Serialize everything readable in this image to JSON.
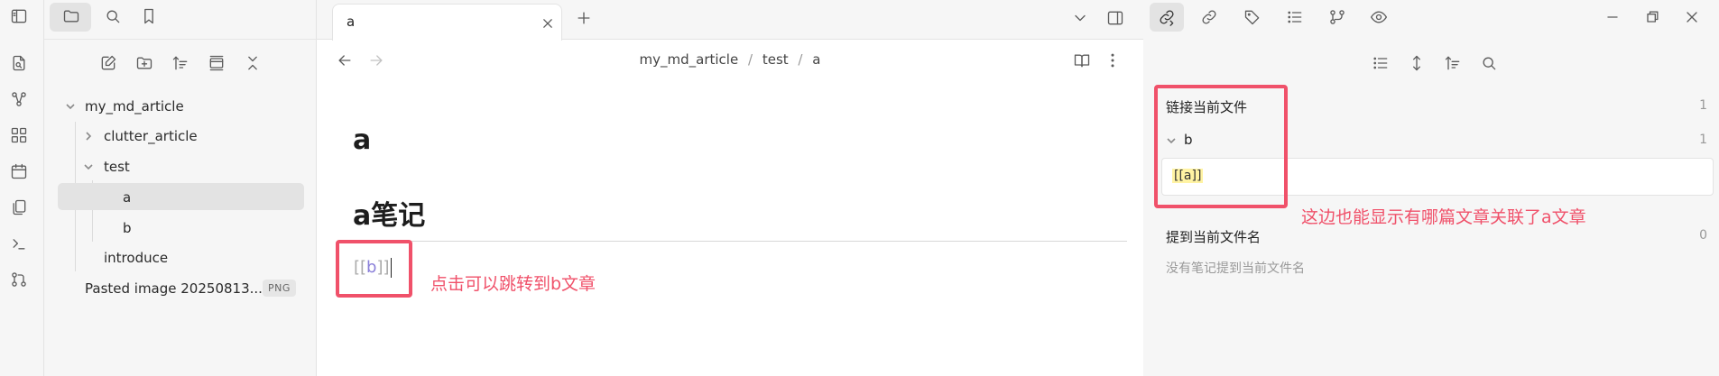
{
  "ribbon": {
    "icons": [
      "sidebar-toggle-icon",
      "quick-switcher-icon",
      "graph-icon",
      "canvas-icon",
      "calendar-icon",
      "templates-icon",
      "terminal-icon",
      "git-icon"
    ]
  },
  "file_explorer": {
    "tree": [
      {
        "name": "my_md_article",
        "type": "folder",
        "expanded": true
      },
      {
        "name": "clutter_article",
        "type": "folder",
        "expanded": false
      },
      {
        "name": "test",
        "type": "folder",
        "expanded": true
      },
      {
        "name": "a",
        "type": "file",
        "active": true
      },
      {
        "name": "b",
        "type": "file"
      },
      {
        "name": "introduce",
        "type": "file"
      },
      {
        "name": "Pasted image 20250813...",
        "type": "file",
        "badge": "PNG"
      }
    ]
  },
  "tab": {
    "title": "a"
  },
  "breadcrumb": {
    "parts": [
      "my_md_article",
      "test",
      "a"
    ],
    "separator": "/"
  },
  "note": {
    "title": "a",
    "heading": "a笔记",
    "link_text": "[[b]]"
  },
  "annotations": {
    "left_note": "点击可以跳转到b文章",
    "right_note": "这边也能显示有哪篇文章关联了a文章",
    "color": "#f0516a"
  },
  "backlinks": {
    "linked_title": "链接当前文件",
    "linked_count": "1",
    "linked_file": "b",
    "linked_file_count": "1",
    "linked_snippet": "[[a]]",
    "unlinked_title": "提到当前文件名",
    "unlinked_count": "0",
    "unlinked_empty": "没有笔记提到当前文件名"
  },
  "colors": {
    "background": "#ffffff",
    "sidebar": "#f6f6f6",
    "active_row": "#e3e3e3",
    "link": "#8a7fd9",
    "highlight": "#fff3a3"
  }
}
